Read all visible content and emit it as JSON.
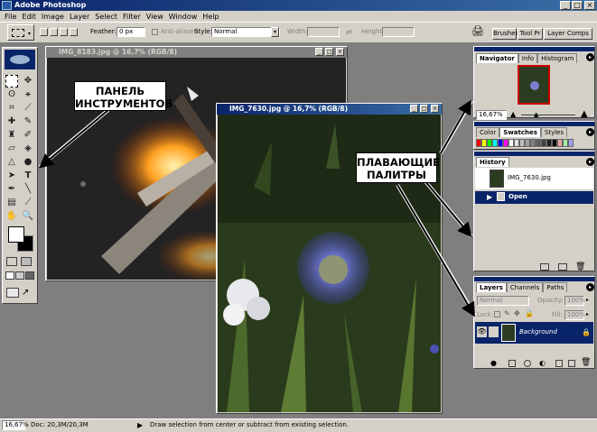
{
  "app": {
    "title": "Adobe Photoshop"
  },
  "menu": [
    "File",
    "Edit",
    "Image",
    "Layer",
    "Select",
    "Filter",
    "View",
    "Window",
    "Help"
  ],
  "options": {
    "feather_label": "Feather:",
    "feather_value": "0 px",
    "antialiased_label": "Anti-aliased",
    "style_label": "Style:",
    "style_value": "Normal",
    "width_label": "Width:",
    "height_label": "Height:",
    "well_tabs": [
      "Brushes",
      "Tool Pr",
      "Layer Comps"
    ]
  },
  "documents": [
    {
      "title": "IMG_8183.jpg @ 16,7% (RGB/8)"
    },
    {
      "title": "IMG_7630.jpg @ 16,7% (RGB/8)"
    }
  ],
  "callouts": {
    "tools": [
      "ПАНЕЛЬ",
      "ИНСТРУМЕНТОВ"
    ],
    "palettes": [
      "ПЛАВАЮЩИЕ",
      "ПАЛИТРЫ"
    ]
  },
  "navigator": {
    "tabs": [
      "Navigator",
      "Info",
      "Histogram"
    ],
    "zoom": "16,67%"
  },
  "swatches": {
    "tabs": [
      "Color",
      "Swatches",
      "Styles"
    ]
  },
  "history": {
    "tab": "History",
    "snapshot": "IMG_7630.jpg",
    "state": "Open"
  },
  "layers": {
    "tabs": [
      "Layers",
      "Channels",
      "Paths"
    ],
    "blend_mode": "Normal",
    "opacity_label": "Opacity:",
    "opacity": "100%",
    "lock_label": "Lock:",
    "fill_label": "Fill:",
    "fill": "100%",
    "layer_name": "Background"
  },
  "status": {
    "zoom": "16,67%",
    "doc": "Doc: 20,3M/20,3M",
    "hint": "Draw selection from center or subtract from existing selection."
  },
  "colors": {
    "titlebar": "#0a246a",
    "chrome": "#d4d0c8",
    "workspace": "#7f7f7f",
    "selection": "#0a246a"
  }
}
